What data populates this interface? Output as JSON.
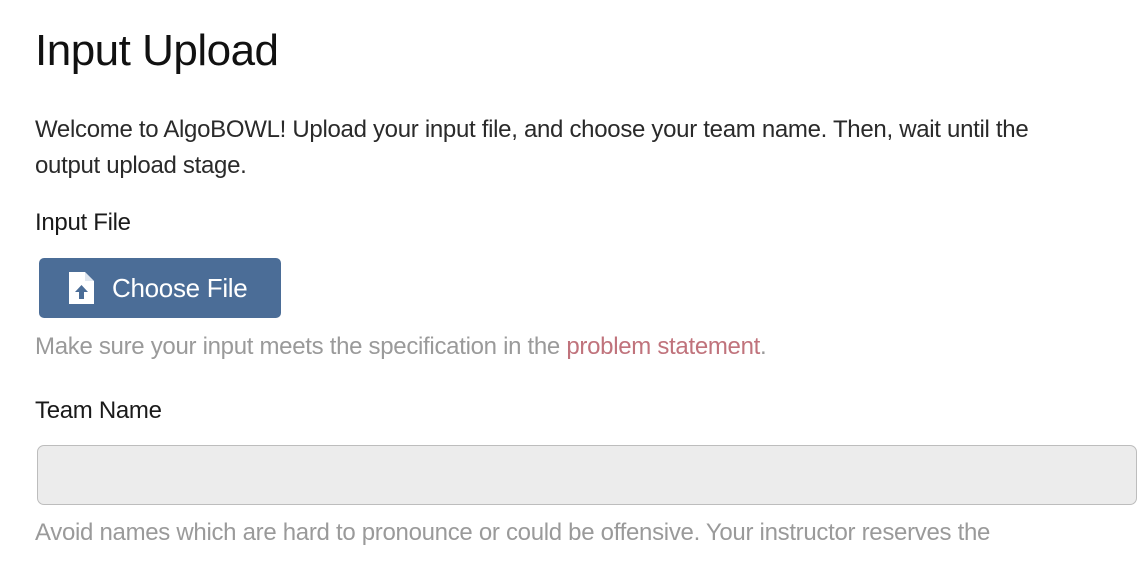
{
  "page": {
    "title": "Input Upload",
    "intro": "Welcome to AlgoBOWL! Upload your input file, and choose your team name. Then, wait until the output upload stage."
  },
  "input_file": {
    "label": "Input File",
    "button_label": "Choose File",
    "button_icon": "file-upload-icon",
    "help_prefix": "Make sure your input meets the specification in the ",
    "help_link": "problem statement",
    "help_suffix": "."
  },
  "team_name": {
    "label": "Team Name",
    "value": "",
    "placeholder": "",
    "help": "Avoid names which are hard to pronounce or could be offensive. Your instructor reserves the"
  },
  "colors": {
    "button_bg": "#4b6d97",
    "link": "#c0737c",
    "help_text": "#9a9a9a",
    "input_bg": "#ececec"
  }
}
